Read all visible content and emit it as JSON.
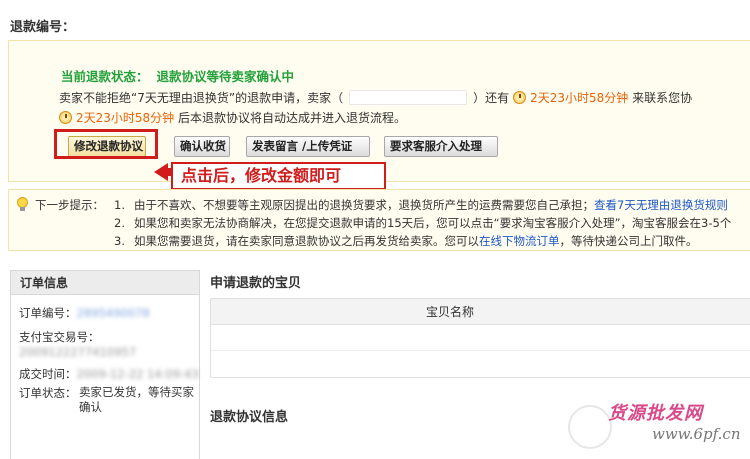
{
  "header": {
    "refund_no_label": "退款编号："
  },
  "status": {
    "label": "当前退款状态：",
    "value": "退款协议等待卖家确认中",
    "line1_a": "卖家不能拒绝“7天无理由退换货”的退款申请，卖家（",
    "line1_b": "）还有",
    "line1_time": "2天23小时58分钟",
    "line1_c": "来联系您协",
    "line2_time": "2天23小时58分钟",
    "line2_a": "后本退款协议将自动达成并进入退货流程。"
  },
  "buttons": {
    "modify": "修改退款协议",
    "confirm": "确认收货",
    "message": "发表留言 /上传凭证",
    "service": "要求客服介入处理"
  },
  "annotation": {
    "callout": "点击后，修改金额即可"
  },
  "tips": {
    "label": "下一步提示：",
    "items": [
      {
        "num": "1.",
        "text": "由于不喜欢、不想要等主观原因提出的退换货要求，退换货所产生的运费需要您自己承担；",
        "link": "查看7天无理由退换货规则"
      },
      {
        "num": "2.",
        "text": "如果您和卖家无法协商解决，在您提交退款申请的15天后，您可以点击“要求淘宝客服介入处理”，淘宝客服会在3-5个"
      },
      {
        "num": "3.",
        "text_a": "如果您需要退货，请在卖家同意退款协议之后再发货给卖家。您可以",
        "link": "在线下物流订单",
        "text_b": "，等待快递公司上门取件。"
      }
    ]
  },
  "order": {
    "title": "订单信息",
    "no_label": "订单编号：",
    "no_value": "2895490078",
    "alipay_label": "支付宝交易号：",
    "alipay_value": "2009122277410957",
    "time_label": "成交时间：",
    "time_value": "2009-12-22 14:09:43",
    "state_label": "订单状态：",
    "state_value": "卖家已发货，等待买家确认"
  },
  "main": {
    "goods_title": "申请退款的宝贝",
    "goods_col": "宝贝名称",
    "agreement_title": "退款协议信息"
  },
  "watermark": {
    "cn": "货源批发网",
    "url": "www.6pf.cn"
  },
  "colors": {
    "status_green": "#23a13a",
    "time_orange": "#e8630a",
    "annotation_red": "#d11c1c",
    "link_blue": "#1d58c4"
  }
}
